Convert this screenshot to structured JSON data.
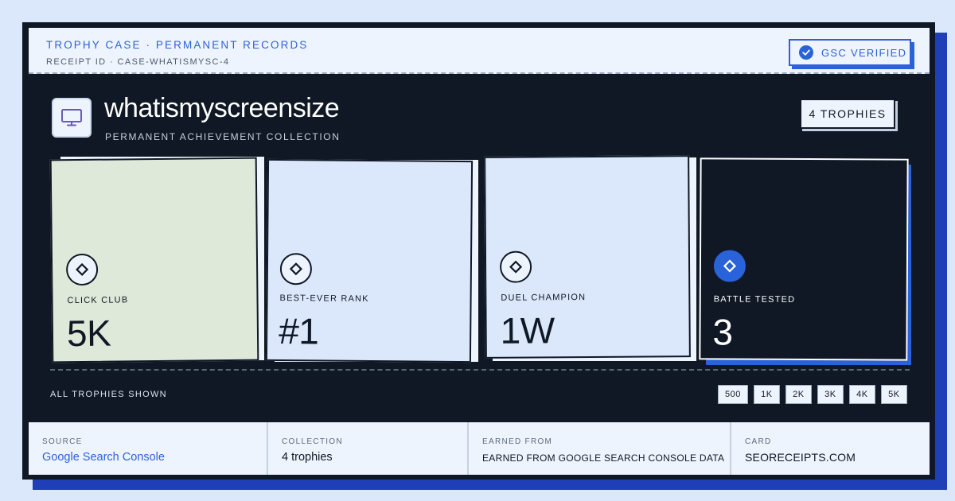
{
  "header": {
    "title": "TROPHY CASE · PERMANENT RECORDS",
    "receipt": "RECEIPT ID · CASE-WHATISMYSC-4",
    "verified_label": "GSC VERIFIED"
  },
  "site": {
    "name": "whatismyscreensize",
    "subtitle": "PERMANENT ACHIEVEMENT COLLECTION",
    "logo_icon": "monitor-icon",
    "trophy_count": "4 TROPHIES"
  },
  "tiles": [
    {
      "label": "CLICK CLUB",
      "value": "5K",
      "bg": "#dfe9da",
      "icon": "diamond-icon"
    },
    {
      "label": "BEST-EVER RANK",
      "value": "#1",
      "bg": "#dbe8fc",
      "icon": "diamond-icon"
    },
    {
      "label": "DUEL CHAMPION",
      "value": "1W",
      "bg": "#dbe8fc",
      "icon": "diamond-icon"
    },
    {
      "label": "BATTLE TESTED",
      "value": "3",
      "bg": "#0f1824",
      "icon": "diamond-icon"
    }
  ],
  "all_shown": "ALL TROPHIES SHOWN",
  "milestones": [
    "500",
    "1K",
    "2K",
    "3K",
    "4K",
    "5K"
  ],
  "footer": {
    "source_label": "SOURCE",
    "source_value": "Google Search Console",
    "collection_label": "COLLECTION",
    "collection_value": "4 trophies",
    "earned_label": "EARNED FROM",
    "earned_value": "EARNED FROM GOOGLE SEARCH CONSOLE DATA",
    "card_label": "CARD",
    "card_value": "SEORECEIPTS.COM"
  },
  "colors": {
    "accent": "#2a62d9",
    "ink": "#0f1824",
    "paper": "#eef4fe"
  }
}
